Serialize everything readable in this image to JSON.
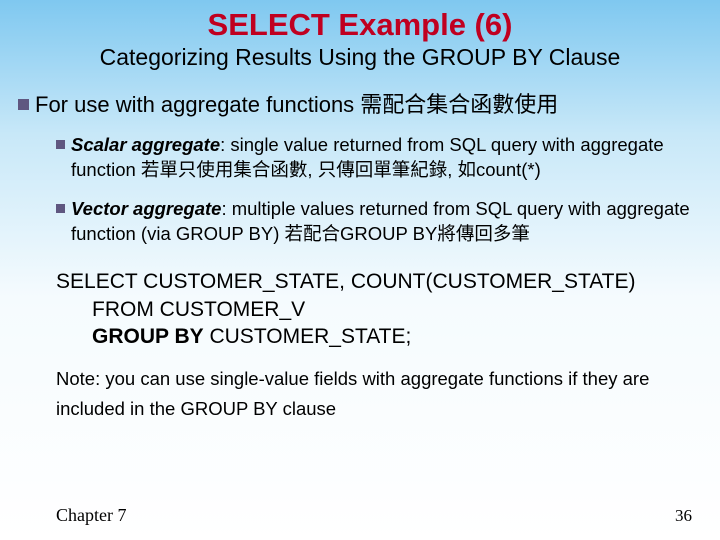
{
  "title": "SELECT Example (6)",
  "subtitle": "Categorizing Results Using the GROUP BY Clause",
  "main_point": "For use with aggregate functions 需配合集合函數使用",
  "sub1": {
    "term": "Scalar aggregate",
    "rest": ": single value returned from SQL query with aggregate function 若單只使用集合函數, 只傳回單筆紀錄, 如count(*)"
  },
  "sub2": {
    "term": "Vector aggregate",
    "rest": ": multiple values returned from SQL query with aggregate function (via GROUP BY) 若配合GROUP BY將傳回多筆"
  },
  "sql": {
    "line1": "SELECT CUSTOMER_STATE, COUNT(CUSTOMER_STATE)",
    "line2": "FROM CUSTOMER_V",
    "line3_bold": "GROUP BY",
    "line3_rest": " CUSTOMER_STATE;"
  },
  "note": "Note: you can use single-value fields with aggregate functions if they are included in the GROUP BY clause",
  "chapter": "Chapter 7",
  "page": "36"
}
